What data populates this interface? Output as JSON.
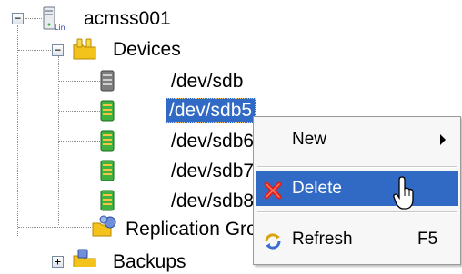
{
  "tree": {
    "root": {
      "label": "acmss001",
      "icon": "linux-server-icon"
    },
    "devices": {
      "label": "Devices",
      "icon": "devices-folder-icon",
      "items": [
        {
          "label": "/dev/sdb",
          "icon": "disk-gray-icon"
        },
        {
          "label": "/dev/sdb5",
          "icon": "disk-green-icon",
          "selected": true
        },
        {
          "label": "/dev/sdb6",
          "icon": "disk-green-icon"
        },
        {
          "label": "/dev/sdb7",
          "icon": "disk-green-icon"
        },
        {
          "label": "/dev/sdb8",
          "icon": "disk-green-icon"
        }
      ]
    },
    "replication": {
      "label": "Replication Groups",
      "icon": "replication-groups-icon"
    },
    "backups": {
      "label": "Backups",
      "icon": "backups-folder-icon"
    },
    "lin_badge": "Lin"
  },
  "context_menu": {
    "items": [
      {
        "label": "New",
        "submenu": true
      },
      {
        "label": "Delete",
        "icon": "delete-x-icon",
        "highlighted": true
      },
      {
        "label": "Refresh",
        "shortcut": "F5",
        "icon": "refresh-icon"
      }
    ]
  },
  "colors": {
    "selection": "#316ac5",
    "menu_bg": "#f7f7f7",
    "disk_green": "#3fb23f",
    "delete_red": "#e0201a"
  }
}
